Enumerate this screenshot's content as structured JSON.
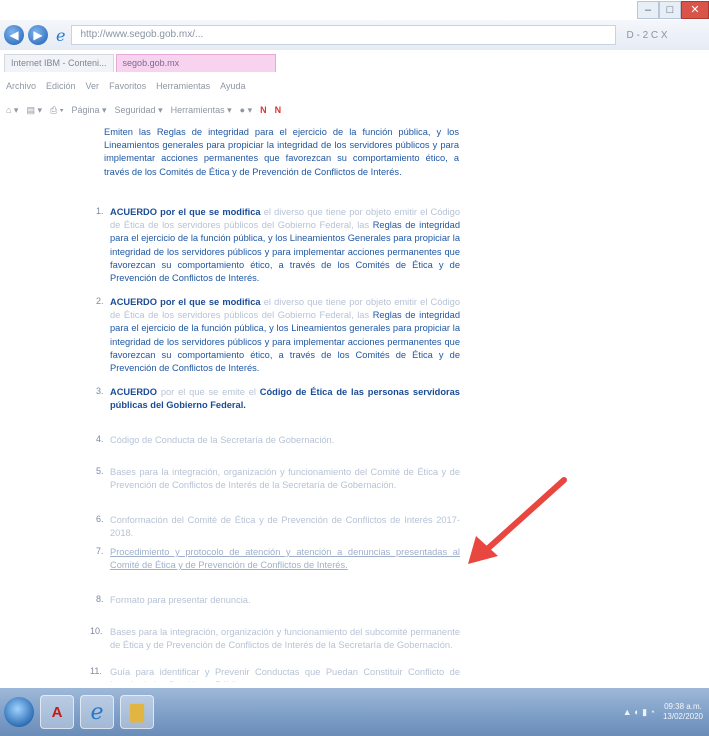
{
  "window": {
    "minimize": "–",
    "maximize": "□",
    "close": "✕"
  },
  "address": {
    "url": "http://www.segob.gob.mx/...",
    "tools": "D - 2 C X"
  },
  "tabs": [
    {
      "label": "Internet IBM - Conteni..."
    },
    {
      "label": "segob.gob.mx"
    }
  ],
  "menu": [
    "Archivo",
    "Edición",
    "Ver",
    "Favoritos",
    "Herramientas",
    "Ayuda"
  ],
  "commands": [
    "Página ▾",
    "Seguridad ▾",
    "Herramientas ▾"
  ],
  "content": {
    "intro": "Emiten las Reglas de integridad para el ejercicio de la función pública, y los Lineamientos generales para propiciar la integridad de los servidores públicos y para implementar acciones permanentes que favorezcan su comportamiento ético, a través de los Comités de Ética y de Prevención de Conflictos de Interés.",
    "items": [
      {
        "num": "1.",
        "lead": "ACUERDO por el que se modifica",
        "faint": "el diverso que tiene por objeto emitir el Código de Ética de los servidores públicos del Gobierno Federal, las",
        "rest": "Reglas de integridad para el ejercicio de la función pública, y los Lineamientos Generales para propiciar la integridad de los servidores públicos y para implementar acciones permanentes que favorezcan su comportamiento ético, a través de los Comités de Ética y de Prevención de Conflictos de Interés."
      },
      {
        "num": "2.",
        "lead": "ACUERDO por el que se modifica",
        "faint": "el diverso que tiene por objeto emitir el Código de Ética de los servidores públicos del Gobierno Federal, las",
        "rest": "Reglas de integridad para el ejercicio de la función pública, y los Lineamientos generales para propiciar la integridad de los servidores públicos y para implementar acciones permanentes que favorezcan su comportamiento ético, a través de los Comités de Ética y de Prevención de Conflictos de Interés."
      },
      {
        "num": "3.",
        "lead": "ACUERDO",
        "faint": "por el que se emite el",
        "rest": "Código de Ética de las personas servidoras públicas del Gobierno Federal."
      },
      {
        "num": "4.",
        "faint_only": "Código de Conducta de la Secretaría de Gobernación."
      },
      {
        "num": "5.",
        "faint_only": "Bases para la integración, organización y funcionamiento del Comité de Ética y de Prevención de Conflictos de Interés de la Secretaría de Gobernación."
      },
      {
        "num": "6.",
        "faint_only": "Conformación del Comité de Ética y de Prevención de Conflictos de Interés 2017-2018."
      },
      {
        "num": "7.",
        "faint_only": "Procedimiento y protocolo de atención y atención a denuncias presentadas al Comité de Ética y de Prevención de Conflictos de Interés."
      },
      {
        "num": "8.",
        "faint_only": "Formato para presentar denuncia."
      },
      {
        "num": "10.",
        "faint_only": "Bases para la integración, organización y funcionamiento del subcomité permanente de Ética y de Prevención de Conflictos de Interés de la Secretaría de Gobernación."
      },
      {
        "num": "11.",
        "faint_only": "Guía para identificar y Prevenir Conductas que Puedan Constituir Conflicto de Interés de los Servidores Públicos."
      }
    ]
  },
  "taskbar": {
    "apps": [
      {
        "name": "acrobat",
        "glyph": "A"
      },
      {
        "name": "internet-explorer",
        "glyph": "e"
      },
      {
        "name": "folder",
        "glyph": "▇"
      }
    ],
    "time": "09:38 a.m.",
    "date": "13/02/2020"
  },
  "colors": {
    "link_blue": "#1f57a4",
    "faint_text": "#b7c3d6",
    "arrow_red": "#e8463f",
    "taskbar": "#7c9dc6"
  }
}
